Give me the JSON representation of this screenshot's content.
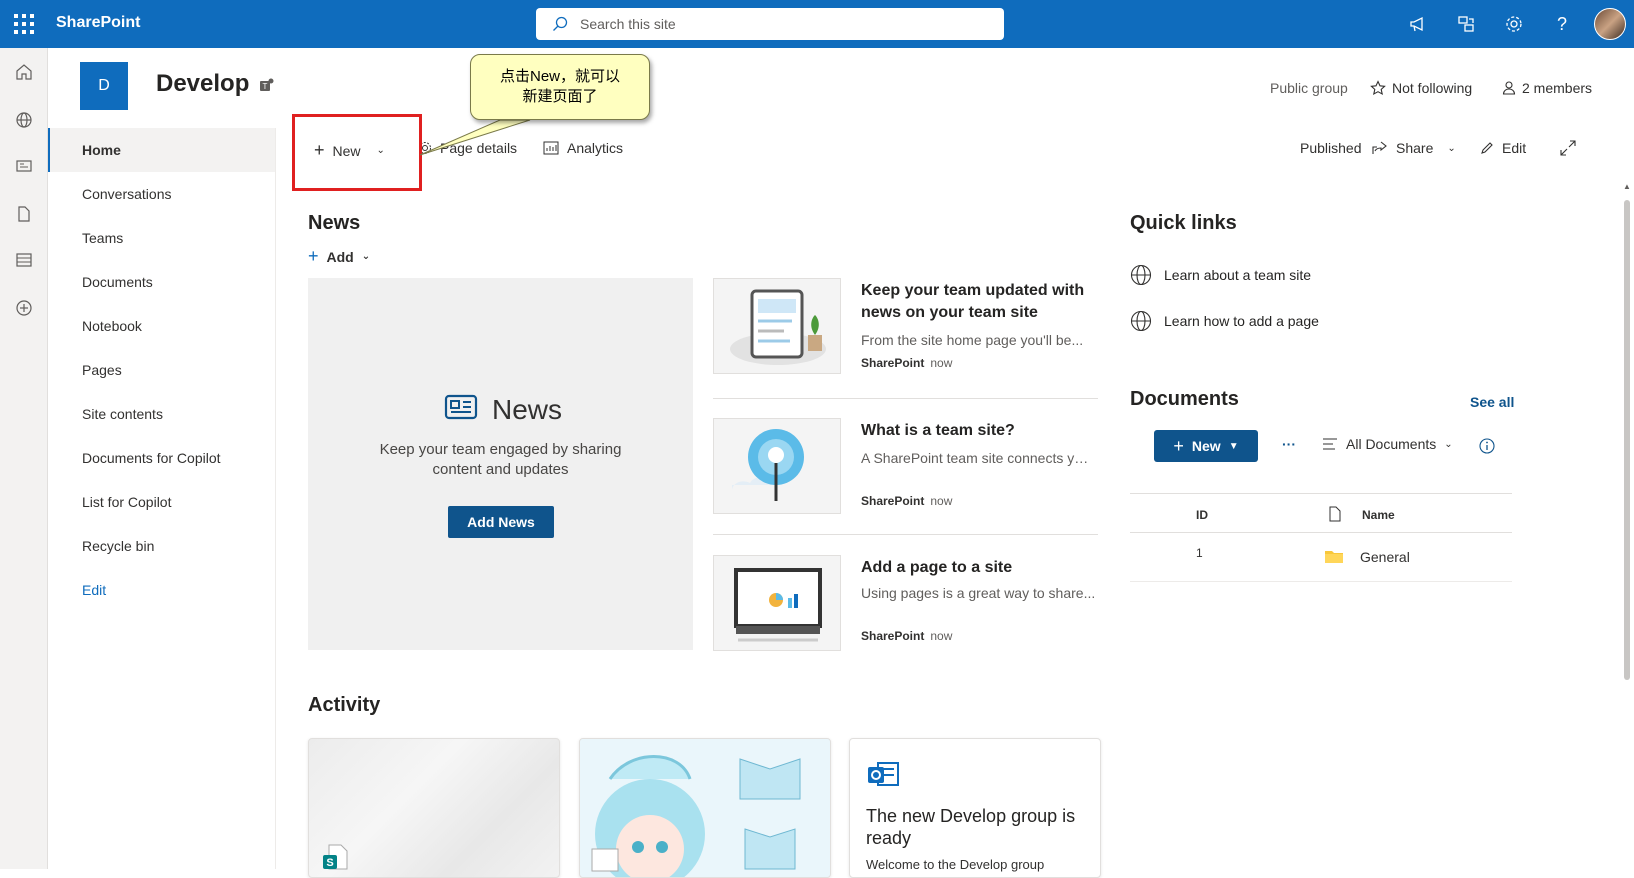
{
  "topbar": {
    "app_name": "SharePoint",
    "search_placeholder": "Search this site"
  },
  "site": {
    "logo_letter": "D",
    "title": "Develop",
    "visibility": "Public group",
    "follow_label": "Not following",
    "members_label": "2 members"
  },
  "leftnav": {
    "items": [
      "Home",
      "Conversations",
      "Teams",
      "Documents",
      "Notebook",
      "Pages",
      "Site contents",
      "Documents for Copilot",
      "List for Copilot",
      "Recycle bin"
    ],
    "edit_label": "Edit"
  },
  "commandbar": {
    "new_label": "New",
    "page_details_label": "Page details",
    "analytics_label": "Analytics",
    "status_label": "Published",
    "share_label": "Share",
    "edit_label": "Edit"
  },
  "callout": {
    "line1": "点击New，就可以",
    "line2": "新建页面了"
  },
  "news": {
    "heading": "News",
    "add_label": "Add",
    "placeholder_title": "News",
    "placeholder_desc": "Keep your team engaged by sharing content and updates",
    "add_news_button": "Add News",
    "items": [
      {
        "title": "Keep your team updated with news on your team site",
        "desc": "From the site home page you'll be...",
        "source": "SharePoint",
        "time": "now"
      },
      {
        "title": "What is a team site?",
        "desc": "A SharePoint team site connects you...",
        "source": "SharePoint",
        "time": "now"
      },
      {
        "title": "Add a page to a site",
        "desc": "Using pages is a great way to share...",
        "source": "SharePoint",
        "time": "now"
      }
    ]
  },
  "quicklinks": {
    "heading": "Quick links",
    "items": [
      "Learn about a team site",
      "Learn how to add a page"
    ]
  },
  "documents": {
    "heading": "Documents",
    "see_all": "See all",
    "new_label": "New",
    "more_label": "···",
    "view_label": "All Documents",
    "col_id": "ID",
    "col_name": "Name",
    "rows": [
      {
        "id": "1",
        "name": "General"
      }
    ]
  },
  "activity": {
    "heading": "Activity",
    "card3_title": "The new Develop group is ready",
    "card3_desc": "Welcome to the Develop group"
  },
  "colors": {
    "brand": "#0f6cbd",
    "button": "#0f548c",
    "highlight": "#e02020",
    "callout_bg": "#ffffc0"
  }
}
